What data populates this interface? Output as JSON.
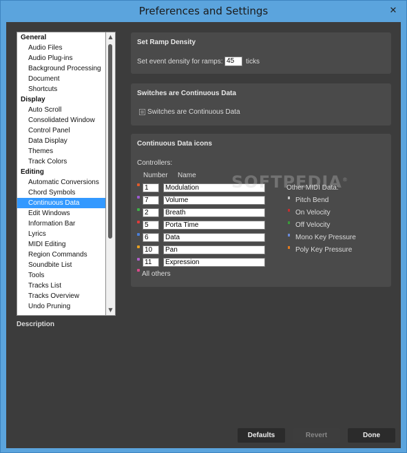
{
  "window": {
    "title": "Preferences and Settings",
    "close_glyph": "✕"
  },
  "sidebar": {
    "items": [
      {
        "label": "General",
        "type": "header"
      },
      {
        "label": "Audio Files",
        "type": "item"
      },
      {
        "label": "Audio Plug-ins",
        "type": "item"
      },
      {
        "label": "Background Processing",
        "type": "item"
      },
      {
        "label": "Document",
        "type": "item"
      },
      {
        "label": "Shortcuts",
        "type": "item"
      },
      {
        "label": "Display",
        "type": "header"
      },
      {
        "label": "Auto Scroll",
        "type": "item"
      },
      {
        "label": "Consolidated Window",
        "type": "item"
      },
      {
        "label": "Control Panel",
        "type": "item"
      },
      {
        "label": "Data Display",
        "type": "item"
      },
      {
        "label": "Themes",
        "type": "item"
      },
      {
        "label": "Track Colors",
        "type": "item"
      },
      {
        "label": "Editing",
        "type": "header"
      },
      {
        "label": "Automatic Conversions",
        "type": "item"
      },
      {
        "label": "Chord Symbols",
        "type": "item"
      },
      {
        "label": "Continuous Data",
        "type": "item",
        "selected": true
      },
      {
        "label": "Edit Windows",
        "type": "item"
      },
      {
        "label": "Information Bar",
        "type": "item"
      },
      {
        "label": "Lyrics",
        "type": "item"
      },
      {
        "label": "MIDI Editing",
        "type": "item"
      },
      {
        "label": "Region Commands",
        "type": "item"
      },
      {
        "label": "Soundbite List",
        "type": "item"
      },
      {
        "label": "Tools",
        "type": "item"
      },
      {
        "label": "Tracks List",
        "type": "item"
      },
      {
        "label": "Tracks Overview",
        "type": "item"
      },
      {
        "label": "Undo Pruning",
        "type": "item"
      }
    ],
    "description_label": "Description"
  },
  "ramp_panel": {
    "title": "Set Ramp Density",
    "label": "Set event density for ramps:",
    "value": "45",
    "unit": "ticks"
  },
  "switches_panel": {
    "title": "Switches are Continuous Data",
    "checkbox_label": "Switches are Continuous Data",
    "checked": false
  },
  "icons_panel": {
    "title": "Continuous Data icons",
    "controllers_label": "Controllers:",
    "col_number": "Number",
    "col_name": "Name",
    "controllers": [
      {
        "number": "1",
        "name": "Modulation",
        "color": "#e05a2b"
      },
      {
        "number": "7",
        "name": "Volume",
        "color": "#9b59d0"
      },
      {
        "number": "2",
        "name": "Breath",
        "color": "#3fae49"
      },
      {
        "number": "5",
        "name": "Porta Time",
        "color": "#e03b3b"
      },
      {
        "number": "6",
        "name": "Data",
        "color": "#4a7fd8"
      },
      {
        "number": "10",
        "name": "Pan",
        "color": "#e8a020"
      },
      {
        "number": "11",
        "name": "Expression",
        "color": "#b060c8"
      }
    ],
    "all_others_label": "All others",
    "all_others_color": "#d84a8a",
    "other_midi_label": "Other MIDI Data:",
    "other_midi": [
      {
        "label": "Pitch Bend",
        "color": "#c0c0c0"
      },
      {
        "label": "On Velocity",
        "color": "#c03030"
      },
      {
        "label": "Off Velocity",
        "color": "#3a9a3a"
      },
      {
        "label": "Mono Key Pressure",
        "color": "#6a8ad8"
      },
      {
        "label": "Poly Key Pressure",
        "color": "#e07a20"
      }
    ]
  },
  "watermark": {
    "text": "SOFTPEDIA",
    "mark": "®"
  },
  "buttons": {
    "defaults": "Defaults",
    "revert": "Revert",
    "done": "Done"
  }
}
